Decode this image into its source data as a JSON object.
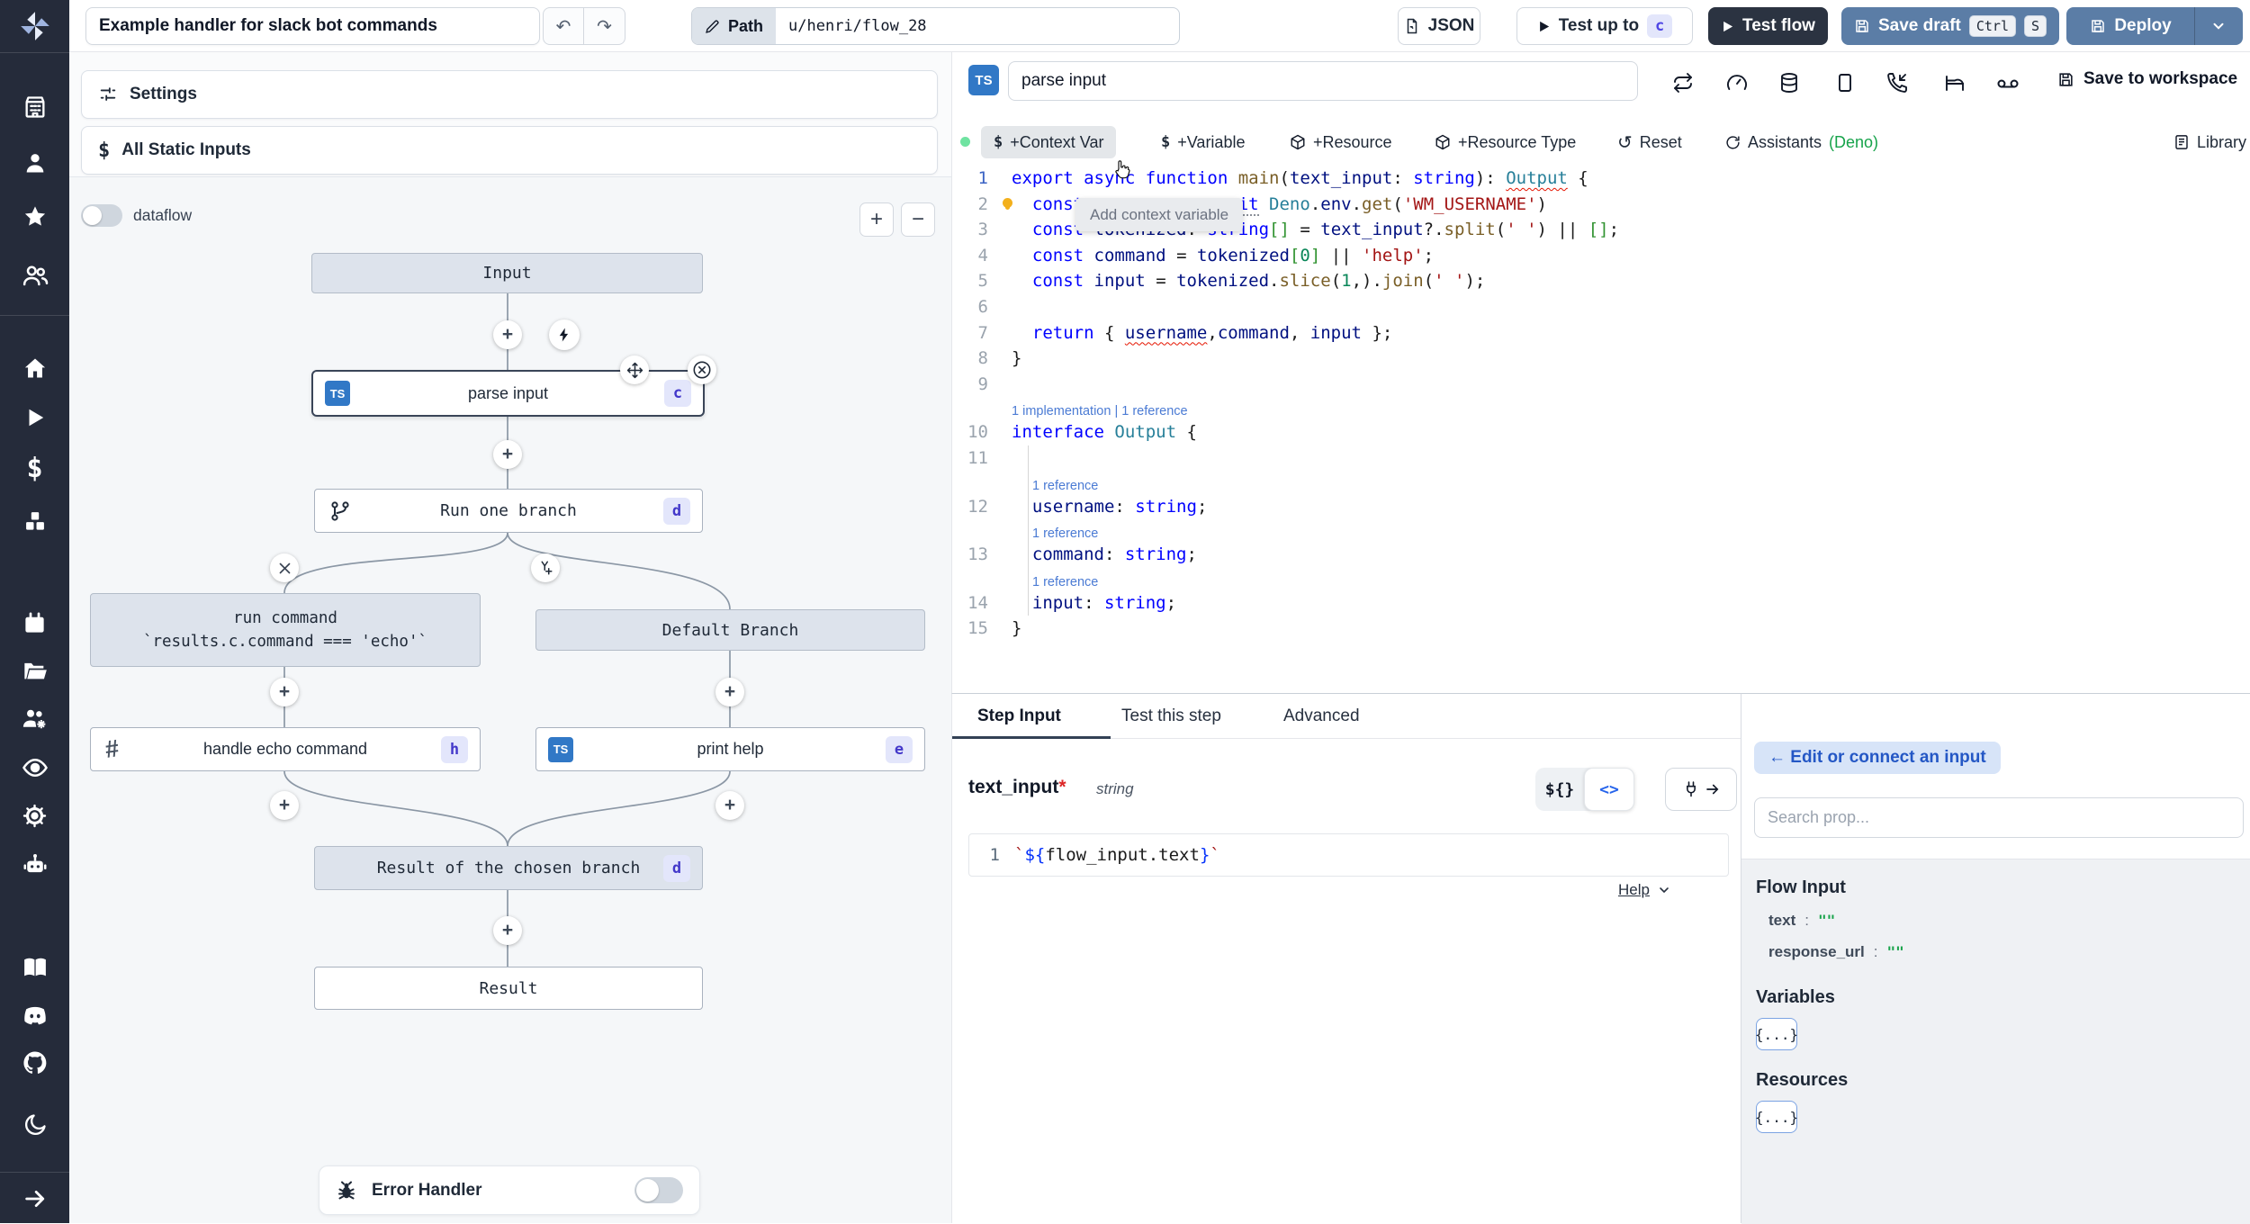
{
  "topbar": {
    "title": "Example handler for slack bot commands",
    "path_label": "Path",
    "path_value": "u/henri/flow_28",
    "json_label": "JSON",
    "test_up_to_label": "Test up to",
    "test_up_to_badge": "c",
    "test_flow_label": "Test flow",
    "save_draft_label": "Save draft",
    "kbd_ctrl": "Ctrl",
    "kbd_s": "S",
    "deploy_label": "Deploy"
  },
  "sidebar": {
    "icons": [
      "windmill-logo",
      "building",
      "user",
      "star",
      "users",
      "home",
      "play",
      "dollar",
      "cubes",
      "calendar",
      "folder-open",
      "users-gear",
      "eye",
      "gear",
      "robot",
      "book-open",
      "discord",
      "github",
      "moon",
      "arrow-right"
    ]
  },
  "flow": {
    "settings_label": "Settings",
    "static_inputs_label": "All Static Inputs",
    "dataflow_label": "dataflow",
    "zoom_in": "+",
    "zoom_out": "−",
    "nodes": {
      "input": "Input",
      "parse": {
        "label": "parse input",
        "badge": "c",
        "lang": "TS"
      },
      "branch_all": {
        "label": "Run one branch",
        "badge": "d"
      },
      "cond": {
        "line1": "run command",
        "line2": "`results.c.command === 'echo'`"
      },
      "default_branch": "Default Branch",
      "echo": {
        "label": "handle echo command",
        "badge": "h"
      },
      "help": {
        "label": "print help",
        "badge": "e",
        "lang": "TS"
      },
      "merged": {
        "label": "Result of the chosen branch",
        "badge": "d"
      },
      "result": "Result"
    },
    "error_handler_label": "Error Handler"
  },
  "editor": {
    "lang_badge": "TS",
    "step_name": "parse input",
    "save_to_workspace": "Save to workspace",
    "icon_names": [
      "refresh-icon",
      "gauge-icon",
      "database-icon",
      "window-icon",
      "phone-incoming-icon",
      "bed-icon",
      "voicemail-icon"
    ],
    "toolbar": {
      "context_var": "+Context Var",
      "variable": "+Variable",
      "resource": "+Resource",
      "resource_type": "+Resource Type",
      "reset": "Reset",
      "assistants": "Assistants",
      "assistants_lang": "(Deno)",
      "library": "Library"
    },
    "tooltip": "Add context variable",
    "code": {
      "lines": [
        {
          "n": "1",
          "t": [
            [
              "kw",
              "export"
            ],
            [
              "p",
              " "
            ],
            [
              "kw",
              "async"
            ],
            [
              "p",
              " "
            ],
            [
              "kw",
              "function"
            ],
            [
              "p",
              " "
            ],
            [
              "fn",
              "main"
            ],
            [
              "p",
              "("
            ],
            [
              "v",
              "text_input"
            ],
            [
              "p",
              ": "
            ],
            [
              "kw",
              "string"
            ],
            [
              "p",
              "): "
            ],
            [
              "ty sq",
              "Output"
            ],
            [
              "p",
              " {"
            ]
          ]
        },
        {
          "n": "2",
          "bulb": true,
          "t": [
            [
              "p",
              "  "
            ],
            [
              "kw",
              "const"
            ],
            [
              "p",
              " "
            ],
            [
              "v",
              "username"
            ],
            [
              "p",
              " = "
            ],
            [
              "kw hint",
              "await"
            ],
            [
              "p",
              " "
            ],
            [
              "ty",
              "Deno"
            ],
            [
              "p",
              "."
            ],
            [
              "v",
              "env"
            ],
            [
              "p",
              "."
            ],
            [
              "fn",
              "get"
            ],
            [
              "p",
              "("
            ],
            [
              "s",
              "'WM_USERNAME'"
            ],
            [
              "p",
              ")"
            ]
          ]
        },
        {
          "n": "3",
          "t": [
            [
              "p",
              "  "
            ],
            [
              "kw",
              "const"
            ],
            [
              "p",
              " "
            ],
            [
              "v",
              "tokenized"
            ],
            [
              "p",
              ": "
            ],
            [
              "kw",
              "string"
            ],
            [
              "bk",
              "[]"
            ],
            [
              "p",
              " = "
            ],
            [
              "v",
              "text_input"
            ],
            [
              "p",
              "?."
            ],
            [
              "fn",
              "split"
            ],
            [
              "p",
              "("
            ],
            [
              "s",
              "' '"
            ],
            [
              "p",
              ") || "
            ],
            [
              "bk",
              "[]"
            ],
            [
              "p",
              ";"
            ]
          ]
        },
        {
          "n": "4",
          "t": [
            [
              "p",
              "  "
            ],
            [
              "kw",
              "const"
            ],
            [
              "p",
              " "
            ],
            [
              "v",
              "command"
            ],
            [
              "p",
              " = "
            ],
            [
              "v",
              "tokenized"
            ],
            [
              "bk",
              "["
            ],
            [
              "nm",
              "0"
            ],
            [
              "bk",
              "]"
            ],
            [
              "p",
              " || "
            ],
            [
              "s",
              "'help'"
            ],
            [
              "p",
              ";"
            ]
          ]
        },
        {
          "n": "5",
          "t": [
            [
              "p",
              "  "
            ],
            [
              "kw",
              "const"
            ],
            [
              "p",
              " "
            ],
            [
              "v",
              "input"
            ],
            [
              "p",
              " = "
            ],
            [
              "v",
              "tokenized"
            ],
            [
              "p",
              "."
            ],
            [
              "fn",
              "slice"
            ],
            [
              "p",
              "("
            ],
            [
              "nm",
              "1"
            ],
            [
              "p",
              ",)."
            ],
            [
              "fn",
              "join"
            ],
            [
              "p",
              "("
            ],
            [
              "s",
              "' '"
            ],
            [
              "p",
              ");"
            ]
          ]
        },
        {
          "n": "6",
          "t": []
        },
        {
          "n": "7",
          "t": [
            [
              "p",
              "  "
            ],
            [
              "kw",
              "return"
            ],
            [
              "p",
              " { "
            ],
            [
              "v sq",
              "username"
            ],
            [
              "p",
              ","
            ],
            [
              "v",
              "command"
            ],
            [
              "p",
              ", "
            ],
            [
              "v",
              "input"
            ],
            [
              "p",
              " };"
            ]
          ]
        },
        {
          "n": "8",
          "t": [
            [
              "p",
              "}"
            ]
          ]
        },
        {
          "n": "9",
          "t": []
        },
        {
          "lens": "1 implementation | 1 reference"
        },
        {
          "n": "10",
          "t": [
            [
              "kw",
              "interface"
            ],
            [
              "p",
              " "
            ],
            [
              "ty",
              "Output"
            ],
            [
              "p",
              " {"
            ]
          ]
        },
        {
          "n": "11",
          "t": [],
          "guide": true
        },
        {
          "lens": "1 reference",
          "indent": true,
          "guide": true
        },
        {
          "n": "12",
          "t": [
            [
              "p",
              "  "
            ],
            [
              "v",
              "username"
            ],
            [
              "p",
              ": "
            ],
            [
              "kw",
              "string"
            ],
            [
              "p",
              ";"
            ]
          ],
          "guide": true
        },
        {
          "lens": "1 reference",
          "indent": true,
          "guide": true
        },
        {
          "n": "13",
          "t": [
            [
              "p",
              "  "
            ],
            [
              "v",
              "command"
            ],
            [
              "p",
              ": "
            ],
            [
              "kw",
              "string"
            ],
            [
              "p",
              ";"
            ]
          ],
          "guide": true
        },
        {
          "lens": "1 reference",
          "indent": true,
          "guide": true
        },
        {
          "n": "14",
          "t": [
            [
              "p",
              "  "
            ],
            [
              "v",
              "input"
            ],
            [
              "p",
              ": "
            ],
            [
              "kw",
              "string"
            ],
            [
              "p",
              ";"
            ]
          ],
          "guide": true
        },
        {
          "n": "15",
          "t": [
            [
              "p",
              "}"
            ]
          ]
        }
      ]
    }
  },
  "step_panel": {
    "tabs": [
      "Step Input",
      "Test this step",
      "Advanced"
    ],
    "field": {
      "name": "text_input",
      "required": "*",
      "type": "string"
    },
    "toggle": {
      "left": "${}",
      "right": "<>"
    },
    "expr_line_number": "1",
    "expr_tokens": [
      [
        "s",
        "`"
      ],
      [
        "bk2",
        "${"
      ],
      [
        "p",
        "flow_input.text"
      ],
      [
        "bk2",
        "}"
      ],
      [
        "s",
        "`"
      ]
    ],
    "help_label": "Help"
  },
  "connect": {
    "edit_button": "← Edit or connect an input",
    "search_placeholder": "Search prop...",
    "flow_input_title": "Flow Input",
    "props": [
      {
        "name": "text",
        "value": "\"\""
      },
      {
        "name": "response_url",
        "value": "\"\""
      }
    ],
    "variables_title": "Variables",
    "resources_title": "Resources",
    "object_chip": "{...}"
  },
  "colors": {
    "accent_blue_button": "#5b7da6",
    "dark_button": "#2b3341",
    "badge_bg": "#e3e6fb",
    "badge_text": "#4f46e5",
    "sidebar_bg": "#252b3a",
    "ts_blue": "#3178c6",
    "string_green": "#18a34a"
  }
}
